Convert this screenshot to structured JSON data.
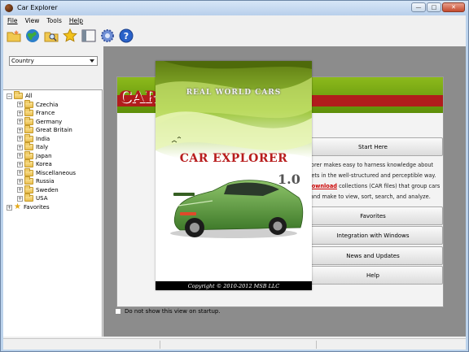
{
  "window": {
    "title": "Car Explorer"
  },
  "menu": [
    "File",
    "View",
    "Tools",
    "Help"
  ],
  "toolbar": [
    "new-folder-icon",
    "globe-icon",
    "search-folder-icon",
    "star-icon",
    "panel-icon",
    "gear-icon",
    "help-icon"
  ],
  "filter": {
    "selected": "Country"
  },
  "tree": {
    "root": "All",
    "items": [
      "Czechia",
      "France",
      "Germany",
      "Great Britain",
      "India",
      "Italy",
      "Japan",
      "Korea",
      "Miscellaneous",
      "Russia",
      "Sweden",
      "USA"
    ],
    "favorites": "Favorites"
  },
  "start_page": {
    "banner": "CAR",
    "start_here": "Start Here",
    "desc": {
      "line1": "xplorer makes easy to harness knowledge about",
      "line2": "arkets in the well-structured and perceptible way.",
      "line3_pre": "y ",
      "line3_link": "download",
      "line3_post": " collections (CAR files) that group cars",
      "line4": "ar and make to view, sort, search, and analyze."
    },
    "buttons": [
      "Favorites",
      "Integration with Windows",
      "News and Updates",
      "Help"
    ],
    "checkbox_label": "Do not show this view on startup."
  },
  "splash": {
    "subtitle": "REAL WORLD CARS",
    "title": "CAR EXPLORER",
    "version": "1.0",
    "copyright": "Copyright © 2010-2012 MSB LLC"
  }
}
